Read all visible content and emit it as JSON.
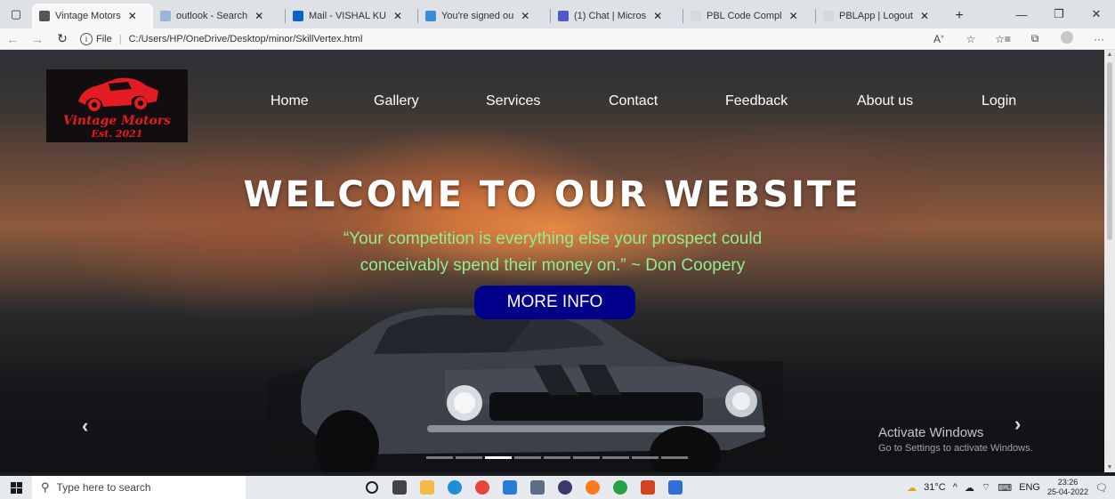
{
  "browser": {
    "tabs": [
      {
        "title": "Vintage Motors",
        "active": true,
        "icon": "page-icon",
        "color": "#555555"
      },
      {
        "title": "outlook - Search",
        "active": false,
        "icon": "search-icon",
        "color": "#9bb5d9"
      },
      {
        "title": "Mail - VISHAL KU",
        "active": false,
        "icon": "outlook-icon",
        "color": "#0a64c8"
      },
      {
        "title": "You're signed ou",
        "active": false,
        "icon": "signed-out-icon",
        "color": "#3c8bd9"
      },
      {
        "title": "(1) Chat | Micros",
        "active": false,
        "icon": "teams-icon",
        "color": "#5059c9"
      },
      {
        "title": "PBL Code Compl",
        "active": false,
        "icon": "page-icon",
        "color": "#d8d8d8"
      },
      {
        "title": "PBLApp | Logout",
        "active": false,
        "icon": "page-icon",
        "color": "#d8d8d8"
      }
    ],
    "url_prefix": "File",
    "url": "C:/Users/HP/OneDrive/Desktop/minor/SkillVertex.html"
  },
  "site": {
    "logo_name": "Vintage Motors",
    "logo_est": "Est. 2021",
    "nav": [
      "Home",
      "Gallery",
      "Services",
      "Contact",
      "Feedback",
      "About us",
      "Login"
    ],
    "hero_title": "WELCOME TO OUR WEBSITE",
    "quote_line1": "“Your competition is everything else your prospect could",
    "quote_line2": "conceivably spend their money on.” ~ Don Coopery",
    "cta": "MORE INFO",
    "carousel_slides": 9,
    "carousel_active": 2
  },
  "watermark": {
    "title": "Activate Windows",
    "subtitle": "Go to Settings to activate Windows."
  },
  "taskbar": {
    "search_placeholder": "Type here to search",
    "temperature": "31°C",
    "language": "ENG",
    "time": "23:26",
    "date": "25-04-2022",
    "apps": [
      {
        "name": "cortana-icon",
        "color": "#222222"
      },
      {
        "name": "task-view-icon",
        "color": "#444444"
      },
      {
        "name": "file-explorer-icon",
        "color": "#f2b84b"
      },
      {
        "name": "edge-icon",
        "color": "#1e8fd6"
      },
      {
        "name": "chrome-icon",
        "color": "#e8453c"
      },
      {
        "name": "store-icon",
        "color": "#2b79d8"
      },
      {
        "name": "camera-icon",
        "color": "#5a6e86"
      },
      {
        "name": "media-icon",
        "color": "#3a3a6a"
      },
      {
        "name": "firefox-icon",
        "color": "#ff7a1a"
      },
      {
        "name": "whatsapp-icon",
        "color": "#25a244"
      },
      {
        "name": "powerpoint-icon",
        "color": "#d04423"
      },
      {
        "name": "cube-icon",
        "color": "#2f6fd6"
      }
    ]
  }
}
